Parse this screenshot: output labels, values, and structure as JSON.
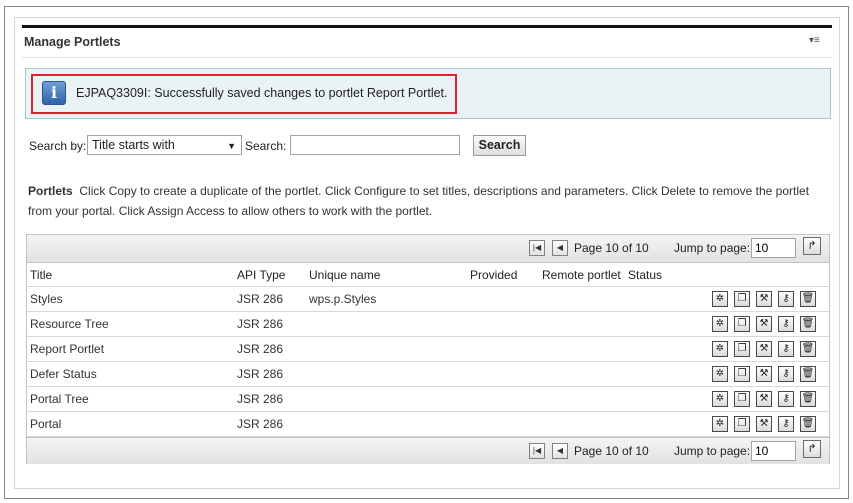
{
  "portlet": {
    "title": "Manage Portlets",
    "menu_glyph": "▾≡"
  },
  "message": {
    "icon": "info-icon",
    "icon_glyph": "i",
    "text": "EJPAQ3309I: Successfully saved changes to portlet Report Portlet."
  },
  "search": {
    "by_label": "Search by:",
    "selected_option": "Title starts with",
    "search_label": "Search:",
    "search_value": "",
    "button_label": "Search"
  },
  "description": {
    "heading": "Portlets",
    "text": "Click Copy to create a duplicate of the portlet. Click Configure to set titles, descriptions and parameters. Click Delete to remove the portlet from your portal. Click Assign Access to allow others to work with the portlet."
  },
  "pager": {
    "first_glyph": "|◀",
    "prev_glyph": "◀",
    "page_text": "Page 10 of 10",
    "jump_label": "Jump to page:",
    "jump_value": "10",
    "go_glyph": "↱"
  },
  "table": {
    "columns": [
      "Title",
      "API Type",
      "Unique name",
      "Provided",
      "Remote portlet",
      "Status"
    ],
    "rows": [
      {
        "title": "Styles",
        "api": "JSR 286",
        "unique": "wps.p.Styles"
      },
      {
        "title": "Resource Tree",
        "api": "JSR 286",
        "unique": ""
      },
      {
        "title": "Report Portlet",
        "api": "JSR 286",
        "unique": ""
      },
      {
        "title": "Defer Status",
        "api": "JSR 286",
        "unique": ""
      },
      {
        "title": "Portal Tree",
        "api": "JSR 286",
        "unique": ""
      },
      {
        "title": "Portal",
        "api": "JSR 286",
        "unique": ""
      }
    ],
    "row_actions": [
      {
        "name": "configure-icon",
        "glyph": "✲"
      },
      {
        "name": "copy-icon",
        "glyph": "❐"
      },
      {
        "name": "wrench-icon",
        "glyph": "⚒"
      },
      {
        "name": "key-icon",
        "glyph": "⚷"
      },
      {
        "name": "delete-icon",
        "glyph": "🗑"
      }
    ]
  }
}
